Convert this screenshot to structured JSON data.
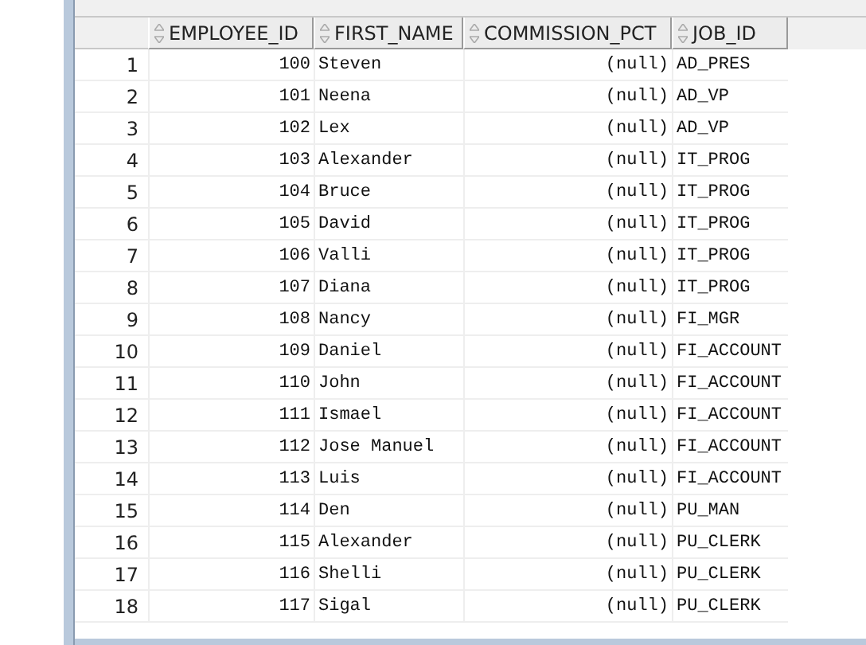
{
  "table": {
    "columns": [
      {
        "label": "EMPLOYEE_ID",
        "kind": "number"
      },
      {
        "label": "FIRST_NAME",
        "kind": "text"
      },
      {
        "label": "COMMISSION_PCT",
        "kind": "number"
      },
      {
        "label": "JOB_ID",
        "kind": "text"
      }
    ],
    "rows": [
      {
        "num": "1",
        "cells": [
          "100",
          "Steven",
          "(null)",
          "AD_PRES"
        ]
      },
      {
        "num": "2",
        "cells": [
          "101",
          "Neena",
          "(null)",
          "AD_VP"
        ]
      },
      {
        "num": "3",
        "cells": [
          "102",
          "Lex",
          "(null)",
          "AD_VP"
        ]
      },
      {
        "num": "4",
        "cells": [
          "103",
          "Alexander",
          "(null)",
          "IT_PROG"
        ]
      },
      {
        "num": "5",
        "cells": [
          "104",
          "Bruce",
          "(null)",
          "IT_PROG"
        ]
      },
      {
        "num": "6",
        "cells": [
          "105",
          "David",
          "(null)",
          "IT_PROG"
        ]
      },
      {
        "num": "7",
        "cells": [
          "106",
          "Valli",
          "(null)",
          "IT_PROG"
        ]
      },
      {
        "num": "8",
        "cells": [
          "107",
          "Diana",
          "(null)",
          "IT_PROG"
        ]
      },
      {
        "num": "9",
        "cells": [
          "108",
          "Nancy",
          "(null)",
          "FI_MGR"
        ]
      },
      {
        "num": "10",
        "cells": [
          "109",
          "Daniel",
          "(null)",
          "FI_ACCOUNT"
        ]
      },
      {
        "num": "11",
        "cells": [
          "110",
          "John",
          "(null)",
          "FI_ACCOUNT"
        ]
      },
      {
        "num": "12",
        "cells": [
          "111",
          "Ismael",
          "(null)",
          "FI_ACCOUNT"
        ]
      },
      {
        "num": "13",
        "cells": [
          "112",
          "Jose Manuel",
          "(null)",
          "FI_ACCOUNT"
        ]
      },
      {
        "num": "14",
        "cells": [
          "113",
          "Luis",
          "(null)",
          "FI_ACCOUNT"
        ]
      },
      {
        "num": "15",
        "cells": [
          "114",
          "Den",
          "(null)",
          "PU_MAN"
        ]
      },
      {
        "num": "16",
        "cells": [
          "115",
          "Alexander",
          "(null)",
          "PU_CLERK"
        ]
      },
      {
        "num": "17",
        "cells": [
          "116",
          "Shelli",
          "(null)",
          "PU_CLERK"
        ]
      },
      {
        "num": "18",
        "cells": [
          "117",
          "Sigal",
          "(null)",
          "PU_CLERK"
        ]
      }
    ]
  }
}
